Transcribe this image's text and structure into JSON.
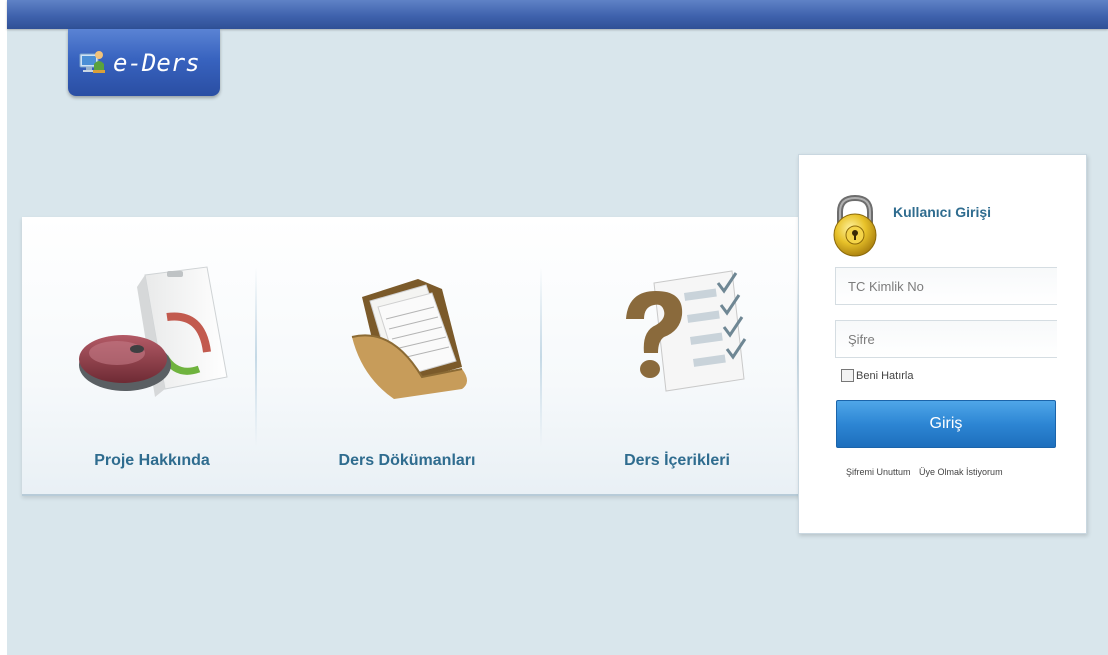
{
  "logo": {
    "text": "e-Ders"
  },
  "tiles": [
    {
      "label": "Proje Hakkında"
    },
    {
      "label": "Ders Dökümanları"
    },
    {
      "label": "Ders İçerikleri"
    }
  ],
  "login": {
    "title": "Kullanıcı Girişi",
    "tc_placeholder": "TC Kimlik No",
    "password_placeholder": "Şifre",
    "remember_label": "Beni Hatırla",
    "submit_label": "Giriş",
    "forgot_link": "Şifremi Unuttum",
    "register_link": "Üye Olmak İstiyorum"
  },
  "colors": {
    "topbar": "#3f62ad",
    "accent_text": "#2f6c8f",
    "button": "#2d86d4",
    "background": "#d9e6ec"
  }
}
